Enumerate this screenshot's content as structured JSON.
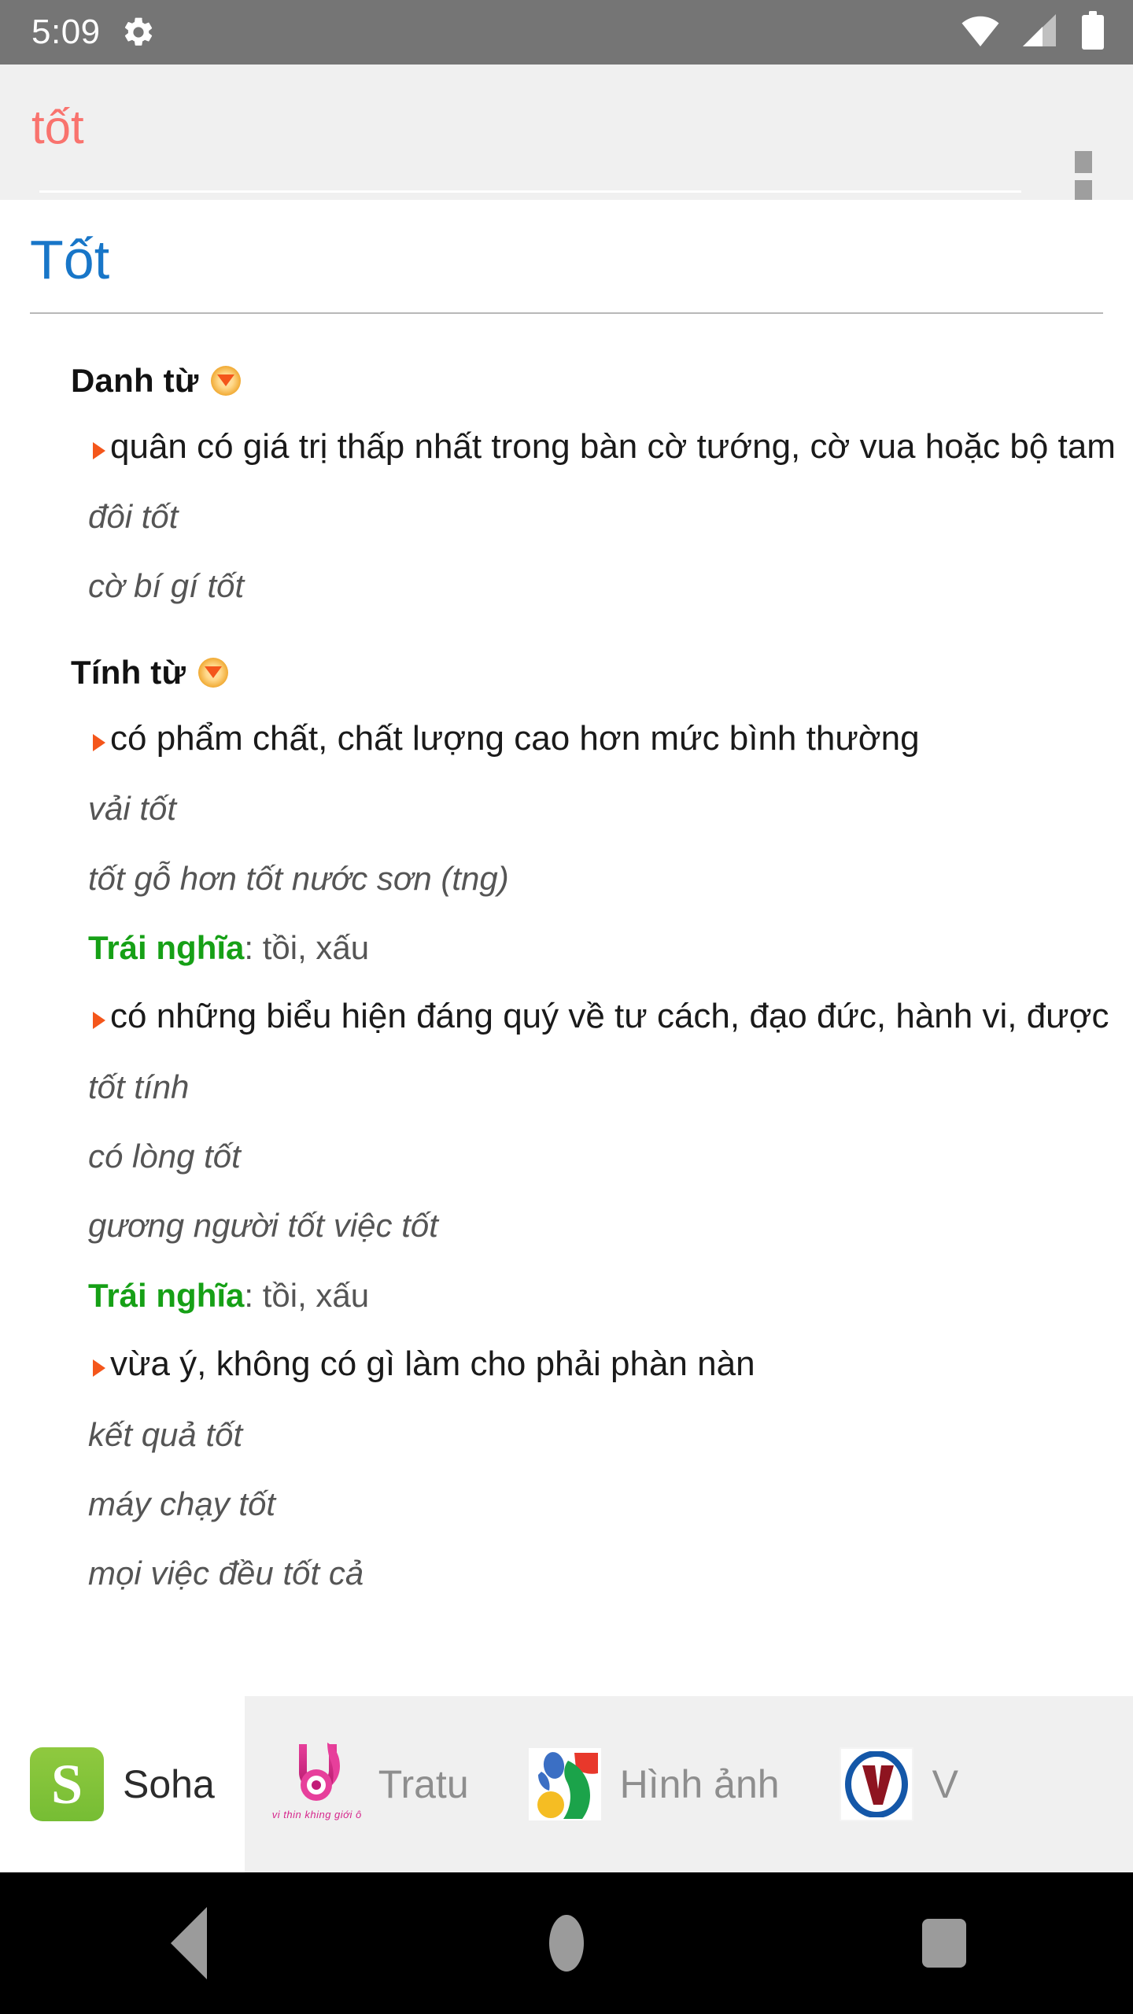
{
  "status_bar": {
    "clock": "5:09",
    "icons": [
      "gear-icon",
      "wifi-icon",
      "cellular-signal-icon",
      "battery-icon"
    ]
  },
  "app_bar": {
    "search_value": "tốt",
    "search_placeholder": "tốt",
    "overflow_label": "⋮"
  },
  "content": {
    "word_title": "Tốt",
    "entries": [
      {
        "pos": "Danh từ",
        "senses": [
          {
            "definition": "quân có giá trị thấp nhất trong bàn cờ tướng, cờ vua hoặc bộ tam",
            "examples": [
              "đôi tốt",
              "cờ bí gí tốt"
            ],
            "antonym_label": "",
            "antonym_value": ""
          }
        ]
      },
      {
        "pos": "Tính từ",
        "senses": [
          {
            "definition": "có phẩm chất, chất lượng cao hơn mức bình thường",
            "examples": [
              "vải tốt",
              "tốt gỗ hơn tốt nước sơn (tng)"
            ],
            "antonym_label": "Trái nghĩa",
            "antonym_value": ": tồi, xấu"
          },
          {
            "definition": "có những biểu hiện đáng quý về tư cách, đạo đức, hành vi, được",
            "examples": [
              "tốt tính",
              "có lòng tốt",
              "gương người tốt việc tốt"
            ],
            "antonym_label": "Trái nghĩa",
            "antonym_value": ": tồi, xấu"
          },
          {
            "definition": "vừa ý, không có gì làm cho phải phàn nàn",
            "examples": [
              "kết quả tốt",
              "máy chạy tốt",
              "mọi việc đều tốt cả"
            ],
            "antonym_label": "",
            "antonym_value": ""
          }
        ]
      }
    ]
  },
  "tabbar": {
    "tabs": [
      {
        "label": "Soha",
        "icon": "soha-icon",
        "active": true,
        "icon_text": "S"
      },
      {
        "label": "Tratu",
        "icon": "tratu-icon",
        "active": false,
        "icon_text": "vi thin khing giới ô"
      },
      {
        "label": "Hình ảnh",
        "icon": "google-images-icon",
        "active": false,
        "icon_text": ""
      },
      {
        "label": "V",
        "icon": "vdict-icon",
        "active": false,
        "icon_text": "V"
      }
    ]
  },
  "nav_bar": {
    "back_label": "back-button",
    "home_label": "home-button",
    "recents_label": "recents-button"
  },
  "colors": {
    "status_bar_bg": "#757575",
    "appbar_bg": "#f0f0f0",
    "search_text": "#f9736e",
    "word_title": "#1876c8",
    "accent_orange": "#f4561b",
    "antonym_green": "#16a016",
    "example_gray": "#555555",
    "tab_inactive_label": "#8e8e8e"
  }
}
